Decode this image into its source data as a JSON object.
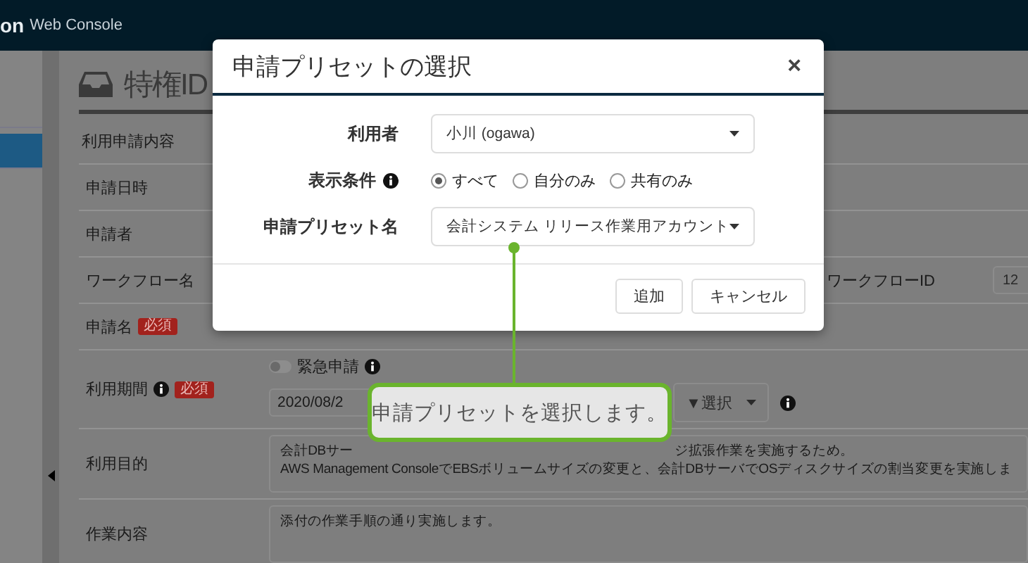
{
  "header": {
    "logo": "on",
    "product": "Web Console"
  },
  "sidebar": {
    "items": [
      {
        "selected": false
      },
      {
        "selected": true
      }
    ]
  },
  "page": {
    "title": "特権ID",
    "section": "利用申請内容"
  },
  "form": {
    "rows": [
      {
        "kind": "plain",
        "label": "申請日時"
      },
      {
        "kind": "plain",
        "label": "申請者"
      },
      {
        "kind": "workflow",
        "label": "ワークフロー名",
        "side_label": "ワークフローID",
        "side_value": "12"
      },
      {
        "kind": "plain",
        "label": "申請名",
        "badge": "必須"
      },
      {
        "kind": "period",
        "label": "利用期間",
        "info": true,
        "badge": "必須",
        "emergency": {
          "label": "緊急申請",
          "on": false,
          "info": true
        },
        "date": "2020/08/2",
        "select": "▼選択",
        "select_info": true
      },
      {
        "kind": "textarea",
        "label": "利用目的",
        "lines": [
          [
            "会計DBサー",
            "ジ拡張作業を実施するため。"
          ],
          [
            "AWS Management ConsoleでEBSボリュームサイズの変更と、会計DBサーバでOSディスクサイズの割当変更を実施しま"
          ]
        ]
      },
      {
        "kind": "textarea",
        "label": "作業内容",
        "lines": [
          [
            "添付の作業手順の通り実施します。"
          ]
        ]
      }
    ]
  },
  "modal": {
    "title": "申請プリセットの選択",
    "close": "×",
    "fields": [
      {
        "kind": "select",
        "label": "利用者",
        "value": "小川 (ogawa)"
      },
      {
        "kind": "radio",
        "label": "表示条件",
        "info": true,
        "options": [
          {
            "label": "すべて",
            "selected": true
          },
          {
            "label": "自分のみ",
            "selected": false
          },
          {
            "label": "共有のみ",
            "selected": false
          }
        ]
      },
      {
        "kind": "select",
        "label": "申請プリセット名",
        "value": "会計システム リリース作業用アカウント"
      }
    ],
    "buttons": [
      "追加",
      "キャンセル"
    ]
  },
  "callout": {
    "text": "申請プリセットを選択します。"
  }
}
